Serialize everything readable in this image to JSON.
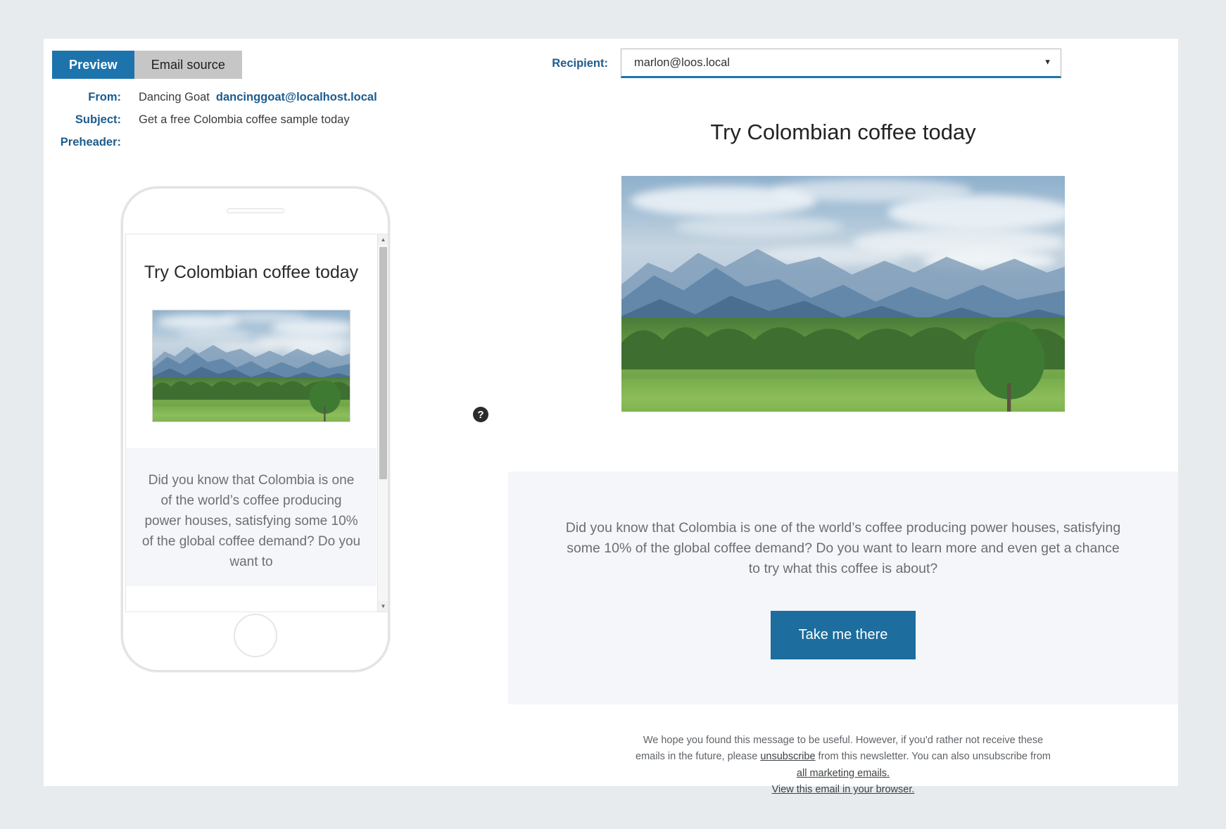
{
  "colors": {
    "page_background": "#e7ebee",
    "panel_background": "#ffffff",
    "accent_blue": "#1d74ad",
    "label_blue": "#1d5c8e",
    "cta_blue": "#1d6d9e",
    "body_section": "#f4f6fa",
    "inactive_tab": "#c6c6c6"
  },
  "tabs": [
    {
      "label": "Preview",
      "active": true,
      "name": "tab-preview"
    },
    {
      "label": "Email source",
      "active": false,
      "name": "tab-email-source"
    }
  ],
  "meta": {
    "from_label": "From:",
    "from_name": "Dancing Goat",
    "from_email": "dancinggoat@localhost.local",
    "subject_label": "Subject:",
    "subject_value": "Get a free Colombia coffee sample today",
    "preheader_label": "Preheader:",
    "preheader_value": ""
  },
  "recipient": {
    "label": "Recipient:",
    "selected": "marlon@loos.local",
    "options": [
      "marlon@loos.local"
    ],
    "caret": "▼"
  },
  "help": {
    "glyph": "?",
    "name": "help-icon"
  },
  "phone_preview": {
    "title": "Try Colombian coffee today",
    "body": "Did you know that Colombia is one of the world’s coffee producing power houses, satisfying some 10% of the global coffee demand? Do you want to",
    "scroll_up": "▲",
    "scroll_down": "▼",
    "image_alt": "Colombian mountain landscape"
  },
  "email": {
    "title": "Try Colombian coffee today",
    "image_alt": "Colombian mountain landscape",
    "body": "Did you know that Colombia is one of the world’s coffee producing power houses, satisfying some 10% of the global coffee demand? Do you want to learn more and even get a chance to try what this coffee is about?",
    "cta_label": "Take me there",
    "footer": {
      "text_part1": "We hope you found this message to be useful. However, if you'd rather not receive these emails in the future, please ",
      "link_unsubscribe": "unsubscribe",
      "text_part2": " from this newsletter. You can also unsubscribe from ",
      "link_all_marketing": "all marketing emails.",
      "link_view_browser": "View this email in your browser."
    }
  }
}
